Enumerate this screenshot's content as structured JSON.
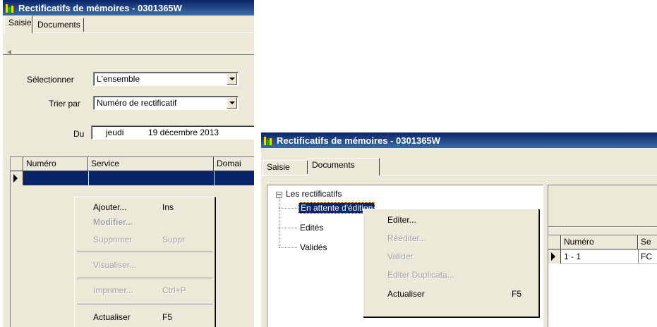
{
  "window1": {
    "title": "Rectificatifs de mémoires - 0301365W",
    "tabs": [
      "Saisie",
      "Documents"
    ],
    "select_label": "Sélectionner",
    "select_value": "L'ensemble",
    "sort_label": "Trier par",
    "sort_value": "Numéro de rectificatif",
    "date_label": "Du",
    "date_day": "jeudi",
    "date_value": "19 décembre 2013",
    "columns": [
      "Numéro",
      "Service",
      "Domai"
    ],
    "menu": {
      "add": "Ajouter...",
      "add_shortcut": "Ins",
      "modify": "Modifier...",
      "delete": "Supprimer",
      "delete_shortcut": "Suppr",
      "view": "Visualiser...",
      "print": "Imprimer...",
      "print_shortcut": "Ctrl+P",
      "refresh": "Actualiser",
      "refresh_shortcut": "F5"
    }
  },
  "window2": {
    "title": "Rectificatifs de mémoires - 0301365W",
    "tabs": [
      "Saisie",
      "Documents"
    ],
    "tree": {
      "root": "Les rectificatifs",
      "children": [
        "En attente d'édition",
        "Edités",
        "Validés"
      ]
    },
    "columns": [
      "Numéro",
      "Se"
    ],
    "row": [
      "1 - 1",
      "FC"
    ],
    "menu": {
      "edit": "Editer...",
      "reedit": "Rééditer...",
      "validate": "Valider",
      "duplicate": "Editer Duplicata...",
      "refresh": "Actualiser",
      "refresh_shortcut": "F5"
    }
  },
  "colors": {
    "title_bar": "#0a246a",
    "selection": "#0a246a",
    "face": "#ece9d8"
  }
}
